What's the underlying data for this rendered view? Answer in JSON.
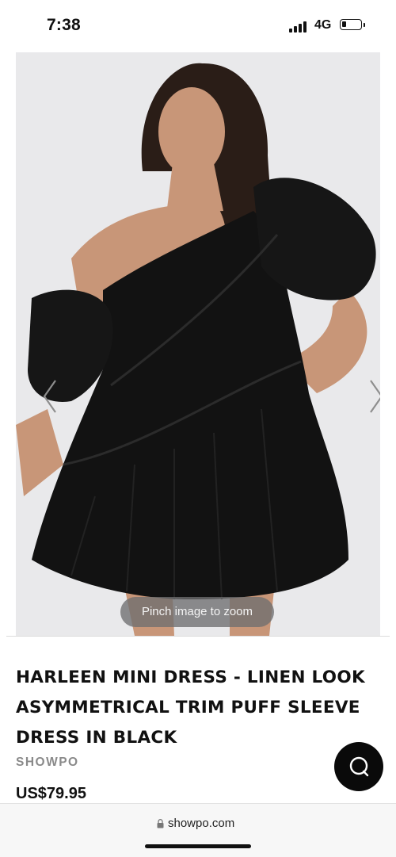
{
  "status_bar": {
    "time": "7:38",
    "network": "4G",
    "icons": [
      "signal-bars-icon",
      "battery-icon"
    ]
  },
  "gallery": {
    "zoom_hint": "Pinch image to zoom",
    "icons": [
      "chevron-left-icon",
      "chevron-right-icon"
    ]
  },
  "product": {
    "title_lines": [
      "HARLEEN MINI DRESS - LINEN LOOK",
      "ASYMMETRICAL TRIM PUFF SLEEVE",
      "DRESS IN BLACK"
    ],
    "brand": "SHOWPO",
    "price": "US$79.95"
  },
  "chat": {
    "icon": "chat-bubble-icon"
  },
  "browser": {
    "url": "showpo.com",
    "icon": "lock-icon"
  },
  "colors": {
    "accent": "#0a0a0a",
    "brand_text": "#8a8a8a",
    "image_bg": "#e9e9eb"
  }
}
